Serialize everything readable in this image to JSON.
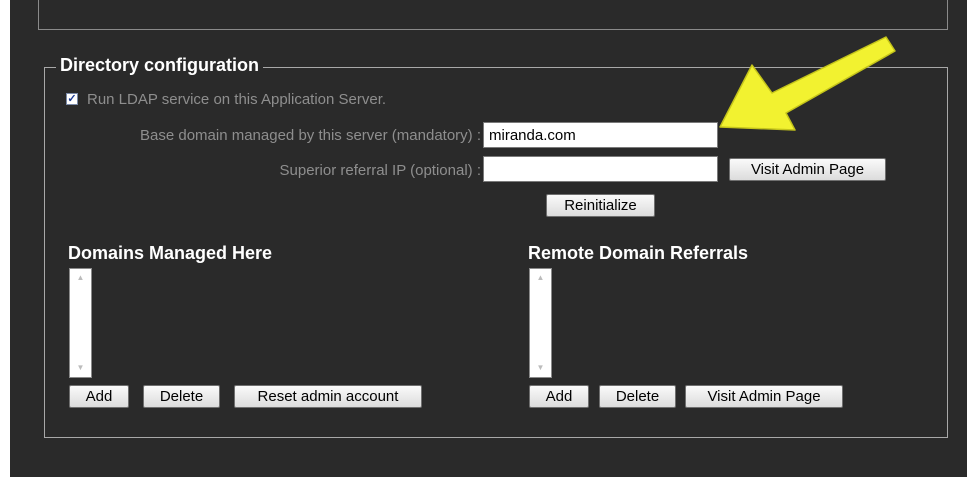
{
  "directory": {
    "legend": "Directory configuration",
    "run_ldap_label": "Run LDAP service on this Application Server.",
    "run_ldap_checked": true,
    "base_domain_label": "Base domain managed by this server (mandatory) :",
    "base_domain_value": "miranda.com",
    "superior_ip_label": "Superior referral IP (optional) :",
    "superior_ip_value": "",
    "visit_admin_label": "Visit Admin Page",
    "reinitialize_label": "Reinitialize"
  },
  "domains": {
    "title": "Domains Managed Here",
    "add_label": "Add",
    "delete_label": "Delete",
    "reset_label": "Reset admin account",
    "items": []
  },
  "remote": {
    "title": "Remote Domain Referrals",
    "add_label": "Add",
    "delete_label": "Delete",
    "visit_admin_label": "Visit Admin Page",
    "items": []
  },
  "colors": {
    "panel_bg": "#2a2a2a",
    "label_text": "#8e8e8e",
    "heading_text": "#ffffff",
    "annotation_arrow": "#f2f230"
  },
  "icons": {
    "check": "checkmark-icon",
    "scroll_up": "scroll-up-arrow-icon",
    "scroll_down": "scroll-down-arrow-icon",
    "annotation": "yellow-arrow-icon"
  }
}
